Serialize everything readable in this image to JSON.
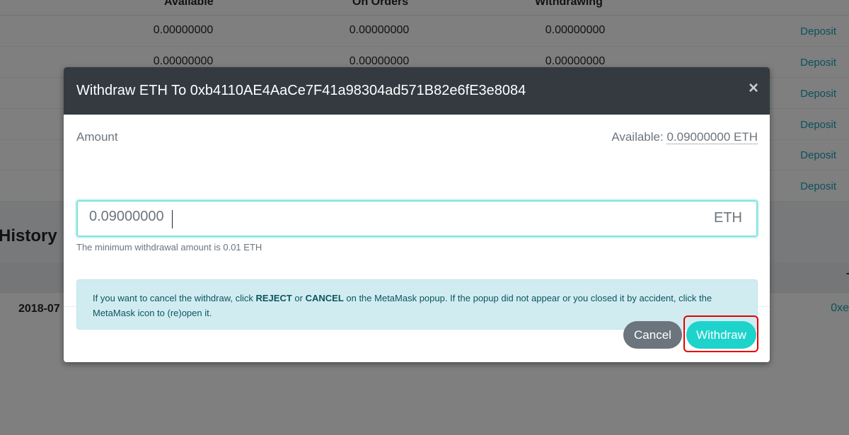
{
  "balances": {
    "headers": [
      "Available",
      "On Orders",
      "Withdrawing"
    ],
    "rows": [
      {
        "available": "0.00000000",
        "on_orders": "0.00000000",
        "withdrawing": "0.00000000",
        "action": "Deposit"
      },
      {
        "available": "0.00000000",
        "on_orders": "0.00000000",
        "withdrawing": "0.00000000",
        "action": "Deposit"
      },
      {
        "available": "",
        "on_orders": "",
        "withdrawing": "",
        "action": "Deposit"
      },
      {
        "available": "",
        "on_orders": "",
        "withdrawing": "",
        "action": "Deposit"
      },
      {
        "available": "",
        "on_orders": "",
        "withdrawing": "",
        "action": "Deposit"
      },
      {
        "available": "",
        "on_orders": "",
        "withdrawing": "",
        "action": "Deposit"
      }
    ]
  },
  "history": {
    "title": "History",
    "header_right": "T",
    "row": {
      "date": "2018-07",
      "hash": "0xe"
    }
  },
  "modal": {
    "title": "Withdraw ETH To 0xb4110AE4AaCe7F41a98304ad571B82e6fE3e8084",
    "close_icon": "×",
    "amount_label": "Amount",
    "available_label": "Available:",
    "available_value": "0.09000000 ETH",
    "amount_value": "0.09000000",
    "unit": "ETH",
    "min_note": "The minimum withdrawal amount is 0.01 ETH",
    "alert": {
      "text_1": "If you want to cancel the withdraw, click ",
      "reject": "REJECT",
      "text_2": " or ",
      "cancel": "CANCEL",
      "text_3": " on the MetaMask popup. If the popup did not appear or you closed it by accident, click the MetaMask icon to (re)open it."
    },
    "cancel_label": "Cancel",
    "withdraw_label": "Withdraw"
  },
  "colors": {
    "header_bg": "#343a40",
    "accent": "#1dd3cc",
    "link": "#17a2b8",
    "highlight": "#e60000"
  }
}
